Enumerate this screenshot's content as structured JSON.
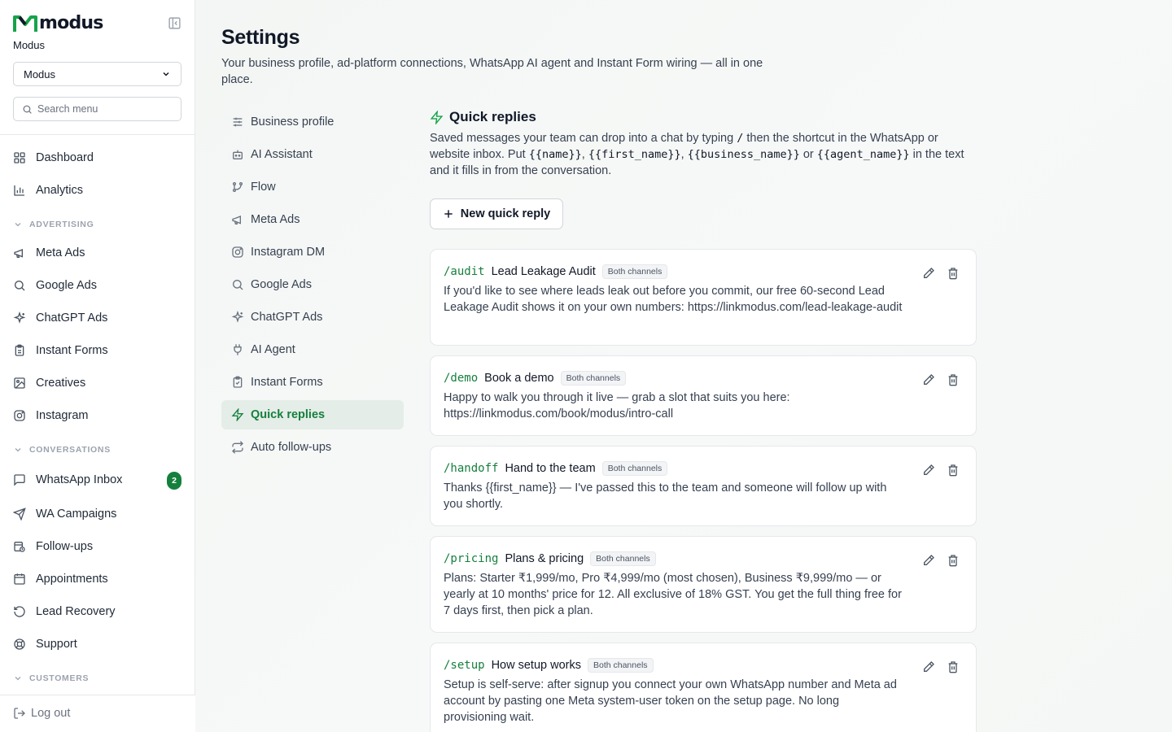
{
  "brand": {
    "name": "modus",
    "org_label": "Modus"
  },
  "org_select": {
    "value": "Modus"
  },
  "search_menu": {
    "placeholder": "Search menu"
  },
  "sidebar": {
    "items": [
      {
        "label": "Dashboard",
        "icon": "grid-icon"
      },
      {
        "label": "Analytics",
        "icon": "bar-chart-icon"
      }
    ],
    "advertising": {
      "title": "ADVERTISING",
      "items": [
        {
          "label": "Meta Ads",
          "icon": "megaphone-icon"
        },
        {
          "label": "Google Ads",
          "icon": "search-icon"
        },
        {
          "label": "ChatGPT Ads",
          "icon": "sparkles-icon"
        },
        {
          "label": "Instant Forms",
          "icon": "clipboard-icon"
        },
        {
          "label": "Creatives",
          "icon": "image-icon"
        },
        {
          "label": "Instagram",
          "icon": "instagram-icon"
        }
      ]
    },
    "conversations": {
      "title": "CONVERSATIONS",
      "items": [
        {
          "label": "WhatsApp Inbox",
          "icon": "message-icon",
          "badge": "2"
        },
        {
          "label": "WA Campaigns",
          "icon": "send-icon"
        },
        {
          "label": "Follow-ups",
          "icon": "calendar-clock-icon"
        },
        {
          "label": "Appointments",
          "icon": "calendar-icon"
        },
        {
          "label": "Lead Recovery",
          "icon": "rotate-icon"
        },
        {
          "label": "Support",
          "icon": "lifebuoy-icon"
        }
      ]
    },
    "customers": {
      "title": "CUSTOMERS"
    },
    "logout": "Log out"
  },
  "page": {
    "title": "Settings",
    "subtitle": "Your business profile, ad-platform connections, WhatsApp AI agent and Instant Form wiring — all in one place."
  },
  "settings_nav": [
    {
      "label": "Business profile",
      "icon": "sliders-icon"
    },
    {
      "label": "AI Assistant",
      "icon": "bot-icon"
    },
    {
      "label": "Flow",
      "icon": "git-branch-icon"
    },
    {
      "label": "Meta Ads",
      "icon": "megaphone-icon"
    },
    {
      "label": "Instagram DM",
      "icon": "instagram-icon"
    },
    {
      "label": "Google Ads",
      "icon": "search-icon"
    },
    {
      "label": "ChatGPT Ads",
      "icon": "sparkles-icon"
    },
    {
      "label": "AI Agent",
      "icon": "plug-icon"
    },
    {
      "label": "Instant Forms",
      "icon": "clipboard-icon"
    },
    {
      "label": "Quick replies",
      "icon": "zap-icon",
      "active": true
    },
    {
      "label": "Auto follow-ups",
      "icon": "repeat-icon"
    }
  ],
  "quick_replies": {
    "title": "Quick replies",
    "desc": {
      "p1": "Saved messages your team can drop into a chat by typing ",
      "slash": "/",
      "p2": " then the shortcut in the WhatsApp or website inbox. Put ",
      "v1": "{{name}}",
      "sep1": ", ",
      "v2": "{{first_name}}",
      "sep2": ", ",
      "v3": "{{business_name}}",
      "sep3": " or ",
      "v4": "{{agent_name}}",
      "p3": " in the text and it fills in from the conversation."
    },
    "new_button": "New quick reply",
    "items": [
      {
        "shortcut": "/audit",
        "title": "Lead Leakage Audit",
        "tag": "Both channels",
        "body": "If you'd like to see where leads leak out before you commit, our free 60-second Lead Leakage Audit shows it on your own numbers: https://linkmodus.com/lead-leakage-audit"
      },
      {
        "shortcut": "/demo",
        "title": "Book a demo",
        "tag": "Both channels",
        "body": "Happy to walk you through it live — grab a slot that suits you here: https://linkmodus.com/book/modus/intro-call"
      },
      {
        "shortcut": "/handoff",
        "title": "Hand to the team",
        "tag": "Both channels",
        "body": "Thanks {{first_name}} — I've passed this to the team and someone will follow up with you shortly."
      },
      {
        "shortcut": "/pricing",
        "title": "Plans & pricing",
        "tag": "Both channels",
        "body": "Plans: Starter ₹1,999/mo, Pro ₹4,999/mo (most chosen), Business ₹9,999/mo — or yearly at 10 months' price for 12. All exclusive of 18% GST. You get the full thing free for 7 days first, then pick a plan."
      },
      {
        "shortcut": "/setup",
        "title": "How setup works",
        "tag": "Both channels",
        "body": "Setup is self-serve: after signup you connect your own WhatsApp number and Meta ad account by pasting one Meta system-user token on the setup page. No long provisioning wait."
      }
    ]
  },
  "colors": {
    "accent": "#16a34a",
    "accent_dark": "#15803d",
    "active_bg": "#e5ede8"
  }
}
